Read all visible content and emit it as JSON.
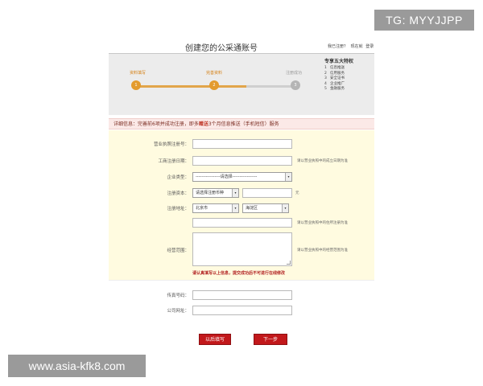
{
  "overlays": {
    "tg_badge": "TG: MYYJJPP",
    "site_badge": "www.asia-kfk8.com"
  },
  "header": {
    "title": "创建您的公采通账号",
    "links": [
      "我已注册？",
      "现在就",
      "登录"
    ]
  },
  "progress": {
    "steps": [
      {
        "label": "资料填写",
        "number": "1",
        "state": "done"
      },
      {
        "label": "完善资料",
        "number": "2",
        "state": "done"
      },
      {
        "label": "注册成功",
        "number": "3",
        "state": "todo"
      }
    ],
    "completed_fraction": 0.55
  },
  "benefits": {
    "title": "专享五大特权",
    "items": [
      {
        "num": "1",
        "text": "信息推送"
      },
      {
        "num": "2",
        "text": "信用服务"
      },
      {
        "num": "3",
        "text": "安全证书"
      },
      {
        "num": "4",
        "text": "企业推广"
      },
      {
        "num": "5",
        "text": "金融服务"
      }
    ]
  },
  "notice": {
    "prefix": "详细信息：完善前6项并成功注册，即多",
    "highlight": "赠送",
    "suffix": "3个月信息推送（手机短信）服务"
  },
  "form": {
    "license_no": {
      "label": "营业执照注册号：",
      "value": ""
    },
    "reg_date": {
      "label": "工商注册日期：",
      "value": "",
      "hint": "请以营业执照中的成立日期为准"
    },
    "company_type": {
      "label": "企业类型：",
      "selected": "-----------------请选择-----------------"
    },
    "capital": {
      "label": "注册资本：",
      "currency_selected": "请选择注册币种",
      "amount": "",
      "unit": "元"
    },
    "address": {
      "label": "注册地址：",
      "city": "北京市",
      "district": "海淀区",
      "detail": "",
      "hint": "请以营业执照中的住所注册为准"
    },
    "scope": {
      "label": "经营范围：",
      "value": "",
      "hint": "请以营业执照中的经营范围为准"
    },
    "warning": "请认真填写以上信息，提交成功后不可进行在线修改",
    "fax": {
      "label": "传真号码：",
      "value": ""
    },
    "website": {
      "label": "公司网址：",
      "value": ""
    }
  },
  "buttons": {
    "later": "以后填写",
    "next": "下一步"
  },
  "colors": {
    "accent_orange": "#e39b2e",
    "button_red": "#c2181b",
    "form_bg": "#fffbe0",
    "notice_bg": "#fbe9e7"
  }
}
